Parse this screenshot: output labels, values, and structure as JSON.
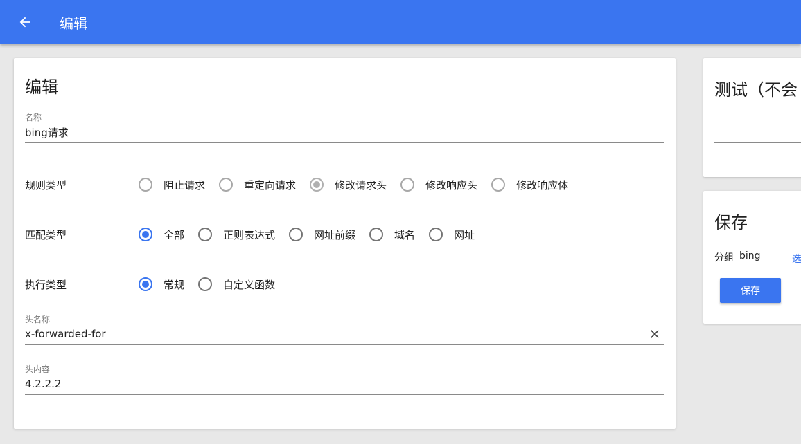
{
  "appbar": {
    "title": "编辑",
    "back_icon": "arrow-left-icon"
  },
  "main": {
    "title": "编辑",
    "name_field": {
      "label": "名称",
      "value": "bing请求"
    },
    "rule_type": {
      "label": "规则类型",
      "options": [
        "阻止请求",
        "重定向请求",
        "修改请求头",
        "修改响应头",
        "修改响应体"
      ],
      "selected": "修改请求头"
    },
    "match_type": {
      "label": "匹配类型",
      "options": [
        "全部",
        "正则表达式",
        "网址前缀",
        "域名",
        "网址"
      ],
      "selected": "全部"
    },
    "exec_type": {
      "label": "执行类型",
      "options": [
        "常规",
        "自定义函数"
      ],
      "selected": "常规"
    },
    "header_name": {
      "label": "头名称",
      "value": "x-forwarded-for"
    },
    "header_value": {
      "label": "头内容",
      "value": "4.2.2.2"
    }
  },
  "test_card": {
    "title": "测试（不会"
  },
  "save_card": {
    "title": "保存",
    "group_label": "分组",
    "group_value": "bing",
    "select_link": "选",
    "save_label": "保存"
  },
  "colors": {
    "accent": "#3a75f0",
    "background": "#e8e8e8"
  }
}
